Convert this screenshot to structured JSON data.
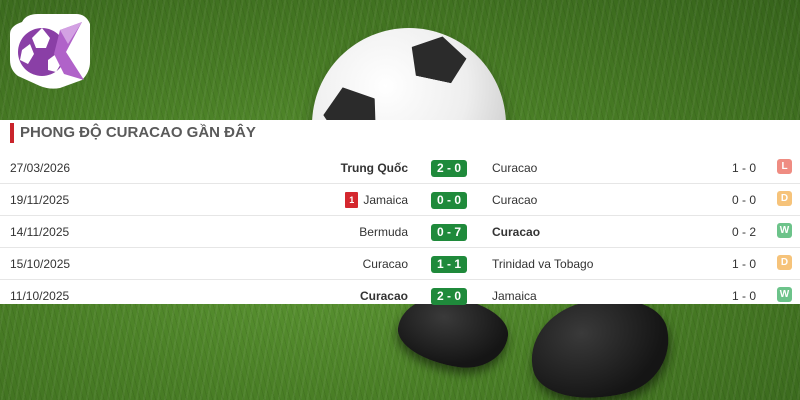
{
  "panel": {
    "title": "PHONG ĐỘ CURACAO GẦN ĐÂY"
  },
  "colors": {
    "accent": "#c9242b",
    "score_bg": "#1f8a3b",
    "loss": "#ef8c82",
    "draw": "#f6c37a",
    "win": "#6cc38a",
    "red_card": "#d4272e"
  },
  "matches": [
    {
      "date": "27/03/2026",
      "home": "Trung Quốc",
      "home_bold": true,
      "red_cards": "",
      "score": "2 - 0",
      "away": "Curacao",
      "away_bold": false,
      "half_time": "1 - 0",
      "result": "L"
    },
    {
      "date": "19/11/2025",
      "home": "Jamaica",
      "home_bold": false,
      "red_cards": "1",
      "score": "0 - 0",
      "away": "Curacao",
      "away_bold": false,
      "half_time": "0 - 0",
      "result": "D"
    },
    {
      "date": "14/11/2025",
      "home": "Bermuda",
      "home_bold": false,
      "red_cards": "",
      "score": "0 - 7",
      "away": "Curacao",
      "away_bold": true,
      "half_time": "0 - 2",
      "result": "W"
    },
    {
      "date": "15/10/2025",
      "home": "Curacao",
      "home_bold": false,
      "red_cards": "",
      "score": "1 - 1",
      "away": "Trinidad va Tobago",
      "away_bold": false,
      "half_time": "1 - 0",
      "result": "D"
    },
    {
      "date": "11/10/2025",
      "home": "Curacao",
      "home_bold": true,
      "red_cards": "",
      "score": "2 - 0",
      "away": "Jamaica",
      "away_bold": false,
      "half_time": "1 - 0",
      "result": "W"
    }
  ]
}
